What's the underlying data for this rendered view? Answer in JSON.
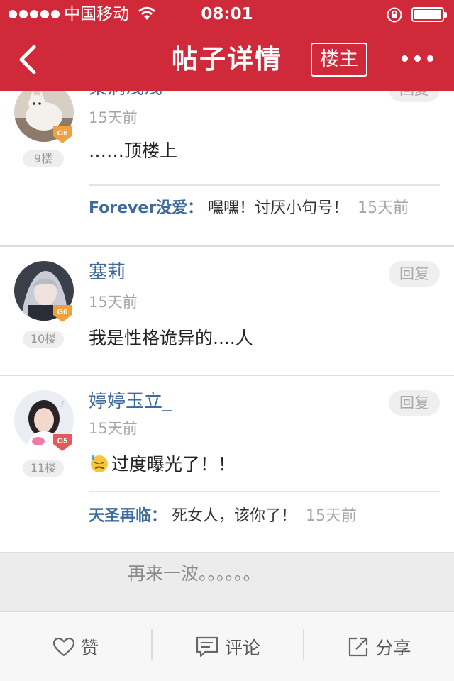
{
  "status_bar": {
    "carrier": "中国移动",
    "time": "08:01",
    "battery_level": 1.0
  },
  "nav": {
    "title": "帖子详情",
    "owner_label": "楼主",
    "back_icon": "chevron-left-icon",
    "more_icon": "more-dots-icon"
  },
  "posts": [
    {
      "username": "梨涡浅浅丶",
      "time": "15天前",
      "floor": "9楼",
      "level": "G6",
      "body": "……顶楼上",
      "reply_label": "回复",
      "subreply": {
        "user": "Forever没爱：",
        "text": "嘿嘿！讨厌小句号！",
        "time": "15天前"
      }
    },
    {
      "username": "塞莉",
      "time": "15天前",
      "floor": "10楼",
      "level": "G6",
      "body": "我是性格诡异的....人",
      "reply_label": "回复"
    },
    {
      "username": "婷婷玉立_",
      "time": "15天前",
      "floor": "11楼",
      "level": "G5",
      "body": "过度曝光了！！",
      "reply_label": "回复",
      "subreply": {
        "user": "天圣再临：",
        "text": "死女人，该你了！",
        "time": "15天前"
      }
    }
  ],
  "more_text": "再来一波。。。。。。",
  "toolbar": {
    "like_label": "赞",
    "comment_label": "评论",
    "share_label": "分享"
  },
  "colors": {
    "brand_red": "#d0293a",
    "username_blue": "#3f6a9c",
    "level_gold": "#f0a040",
    "level_red": "#e35a5a"
  }
}
